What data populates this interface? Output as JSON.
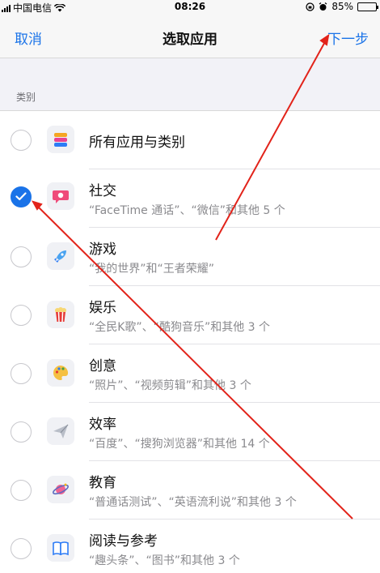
{
  "status_bar": {
    "carrier": "中国电信",
    "time": "08:26",
    "battery": "85%",
    "battery_level": 0.85
  },
  "nav": {
    "cancel_label": "取消",
    "title": "选取应用",
    "next_label": "下一步"
  },
  "section": {
    "header": "类别"
  },
  "categories": [
    {
      "title": "所有应用与类别",
      "subtitle": "",
      "icon": "stack-icon",
      "checked": false
    },
    {
      "title": "社交",
      "subtitle": "“FaceTime 通话”、“微信”和其他 5 个",
      "icon": "chat-bubble-icon",
      "checked": true
    },
    {
      "title": "游戏",
      "subtitle": "“我的世界”和“王者荣耀”",
      "icon": "rocket-icon",
      "checked": false
    },
    {
      "title": "娱乐",
      "subtitle": "“全民K歌”、“酷狗音乐”和其他 3 个",
      "icon": "popcorn-icon",
      "checked": false
    },
    {
      "title": "创意",
      "subtitle": "“照片”、“视频剪辑”和其他 3 个",
      "icon": "palette-icon",
      "checked": false
    },
    {
      "title": "效率",
      "subtitle": "“百度”、“搜狗浏览器”和其他 14 个",
      "icon": "paper-plane-icon",
      "checked": false
    },
    {
      "title": "教育",
      "subtitle": "“普通话测试”、“英语流利说”和其他 3 个",
      "icon": "planet-icon",
      "checked": false
    },
    {
      "title": "阅读与参考",
      "subtitle": "“趣头条”、“图书”和其他 3 个",
      "icon": "book-icon",
      "checked": false
    }
  ],
  "colors": {
    "accent": "#1a73e8",
    "annotation_arrow": "#e2231a"
  }
}
